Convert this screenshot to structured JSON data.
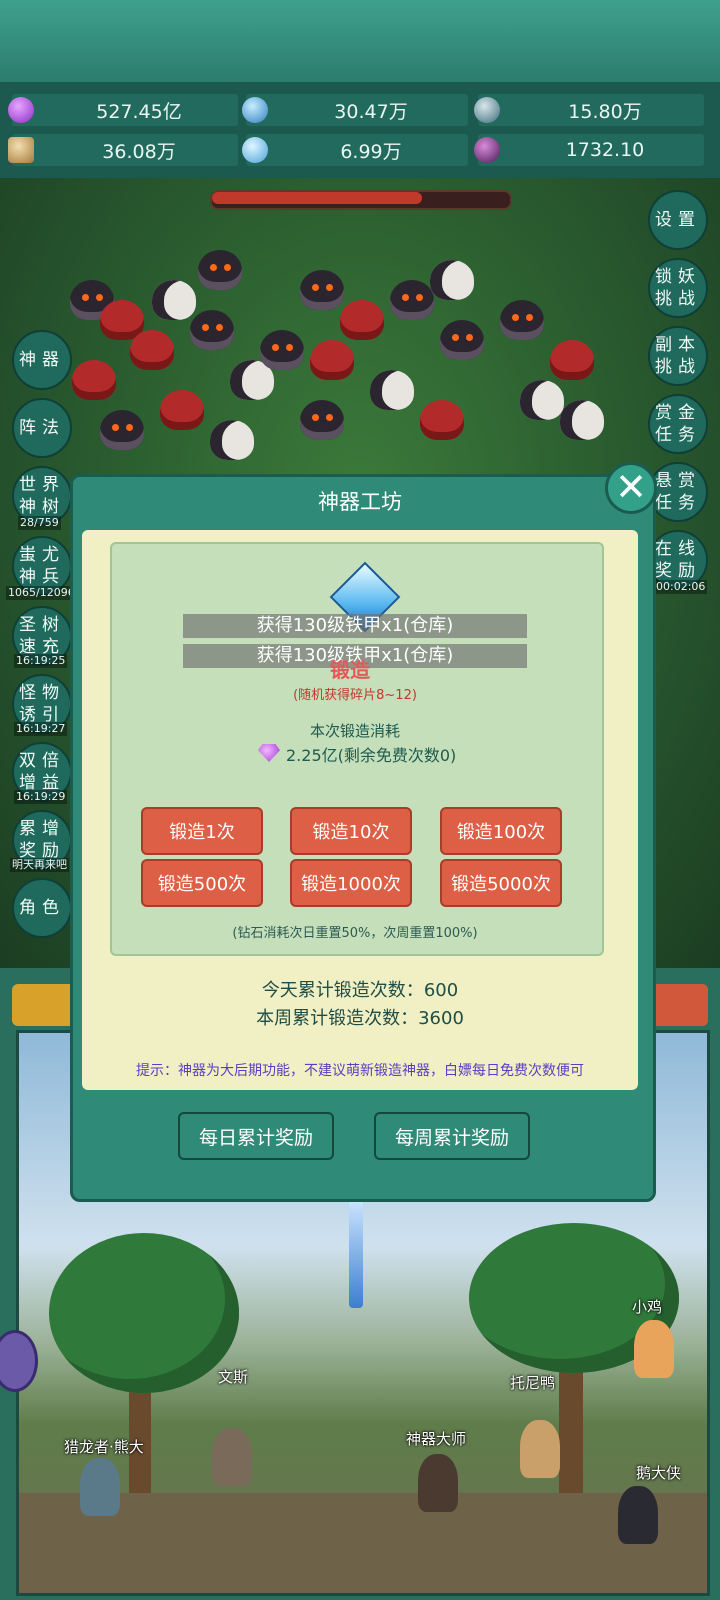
{
  "resources": [
    {
      "icon": "purple-gem-icon",
      "value": "527.45亿"
    },
    {
      "icon": "blue-crystal-icon",
      "value": "30.47万"
    },
    {
      "icon": "steel-orb-icon",
      "value": "15.80万"
    },
    {
      "icon": "scroll-icon",
      "value": "36.08万"
    },
    {
      "icon": "ice-shard-icon",
      "value": "6.99万"
    },
    {
      "icon": "dark-orb-icon",
      "value": "1732.10"
    }
  ],
  "left_menu": {
    "shenqi": "神器",
    "zhenfa": "阵法",
    "world_tree": {
      "line1": "世界",
      "line2": "神树",
      "progress": "28/759"
    },
    "chiyou": {
      "line1": "蚩尤",
      "line2": "神兵",
      "progress": "1065/12096"
    },
    "sacred_tree": {
      "line1": "圣树",
      "line2": "速充",
      "time": "16:19:25"
    },
    "monster_lure": {
      "line1": "怪物",
      "line2": "诱引",
      "time": "16:19:27"
    },
    "double_gain": {
      "line1": "双倍",
      "line2": "增益",
      "time": "16:19:29"
    },
    "cumulative": {
      "line1": "累增",
      "line2": "奖励",
      "note": "明天再来吧"
    },
    "role": "角色"
  },
  "right_menu": {
    "settings": "设置",
    "demon_lock": {
      "line1": "锁妖",
      "line2": "挑战"
    },
    "dungeon": {
      "line1": "副本",
      "line2": "挑战"
    },
    "gold_task": {
      "line1": "赏金",
      "line2": "任务"
    },
    "bounty_task": {
      "line1": "悬赏",
      "line2": "任务"
    },
    "online_reward": {
      "line1": "在线",
      "line2": "奖励",
      "time": "00:02:06"
    }
  },
  "modal": {
    "title": "神器工坊",
    "toasts": [
      "获得130级铁甲x1(仓库)",
      "获得130级铁甲x1(仓库)"
    ],
    "forge_label": "锻造",
    "forge_sub": "(随机获得碎片8~12)",
    "cost_title": "本次锻造消耗",
    "cost_value": "2.25亿(剩余免费次数0)",
    "buttons": [
      "锻造1次",
      "锻造10次",
      "锻造100次",
      "锻造500次",
      "锻造1000次",
      "锻造5000次"
    ],
    "reset_note": "(钻石消耗次日重置50%，次周重置100%)",
    "today_label": "今天累计锻造次数：",
    "today_value": "600",
    "week_label": "本周累计锻造次数：",
    "week_value": "3600",
    "tip": "提示：神器为大后期功能，不建议萌新锻造神器，白嫖每日免费次数便可",
    "daily_reward": "每日累计奖励",
    "weekly_reward": "每周累计奖励"
  },
  "npcs": {
    "xiaoji": "小鸡",
    "wensi": "文斯",
    "tuonya": "托尼鸭",
    "hunter": "猎龙者·熊大",
    "master": "神器大师",
    "goose": "鹅大侠"
  },
  "colors": {
    "accent": "#2f8a77",
    "forge_button": "#dd5f45",
    "panel": "#f1efc4",
    "tip": "#5a3fc2"
  }
}
